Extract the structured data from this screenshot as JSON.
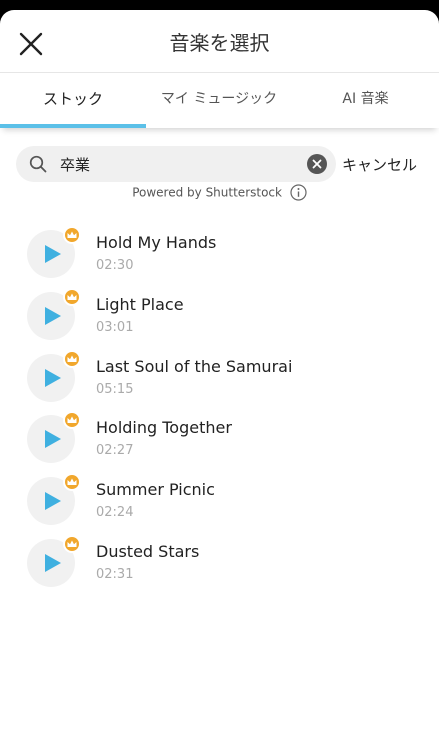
{
  "header": {
    "title": "音楽を選択"
  },
  "tabs": [
    {
      "label": "ストック",
      "active": true
    },
    {
      "label": "マイ ミュージック",
      "active": false
    },
    {
      "label": "AI 音楽",
      "active": false
    }
  ],
  "search": {
    "value": "卒業",
    "cancel_label": "キャンセル"
  },
  "powered_by": "Powered by Shutterstock",
  "tracks": [
    {
      "title": "Hold My Hands",
      "duration": "02:30"
    },
    {
      "title": "Light Place",
      "duration": "03:01"
    },
    {
      "title": "Last Soul of the Samurai",
      "duration": "05:15"
    },
    {
      "title": "Holding Together",
      "duration": "02:27"
    },
    {
      "title": "Summer Picnic",
      "duration": "02:24"
    },
    {
      "title": "Dusted Stars",
      "duration": "02:31"
    }
  ],
  "colors": {
    "accent": "#5bc0e8",
    "play": "#3fb0e0",
    "premium_badge": "#f1a72c"
  }
}
